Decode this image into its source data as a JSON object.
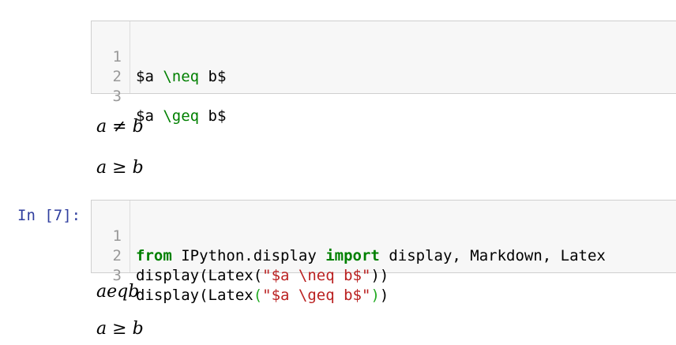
{
  "markdown_cell": {
    "lines": [
      {
        "num": "1",
        "pre": "$a ",
        "cmd": "\\neq",
        "post": " b$"
      },
      {
        "num": "2",
        "pre": "",
        "cmd": "",
        "post": ""
      },
      {
        "num": "3",
        "pre": "$a ",
        "cmd": "\\geq",
        "post": " b$"
      }
    ]
  },
  "rendered_markdown": [
    {
      "left": "a",
      "op": "≠",
      "right": "b"
    },
    {
      "left": "a",
      "op": "≥",
      "right": "b"
    }
  ],
  "code_cell": {
    "prompt": "In [7]:",
    "lines": [
      {
        "num": "1",
        "kw1": "from",
        "mid": " IPython.display ",
        "kw2": "import",
        "rest": " display, Markdown, Latex"
      },
      {
        "num": "2",
        "fn": "display(Latex(",
        "str": "\"$a \\neq b$\"",
        "close": "))"
      },
      {
        "num": "3",
        "fn": "display(Latex",
        "open": "(",
        "str": "\"$a \\geq b$\"",
        "close_inner": ")",
        "close": ")"
      }
    ]
  },
  "outputs": [
    {
      "text": "aeqb"
    },
    {
      "left": "a",
      "op": "≥",
      "right": "b"
    }
  ],
  "colors": {
    "editor_bg": "#f7f7f7",
    "keyword": "#008000",
    "string": "#ba2121",
    "prompt": "#303f9f",
    "line_number": "#999999"
  }
}
